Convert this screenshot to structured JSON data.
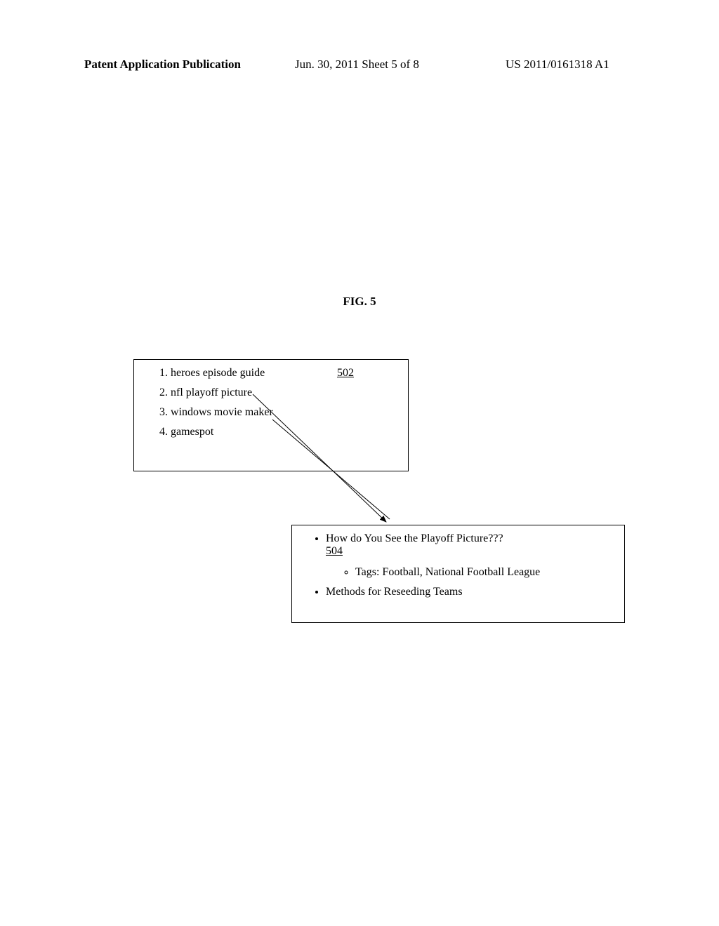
{
  "header": {
    "left": "Patent Application Publication",
    "center": "Jun. 30, 2011  Sheet 5 of 8",
    "right": "US 2011/0161318 A1"
  },
  "figure_label": "FIG. 5",
  "box502": {
    "ref": "502",
    "items": [
      "heroes episode guide",
      "nfl playoff picture",
      "windows movie maker",
      "gamespot"
    ]
  },
  "box504": {
    "ref": "504",
    "items": [
      {
        "text": "How do You See the Playoff Picture???",
        "tags": "Tags: Football, National Football League"
      },
      {
        "text": "Methods for Reseeding Teams"
      }
    ]
  }
}
